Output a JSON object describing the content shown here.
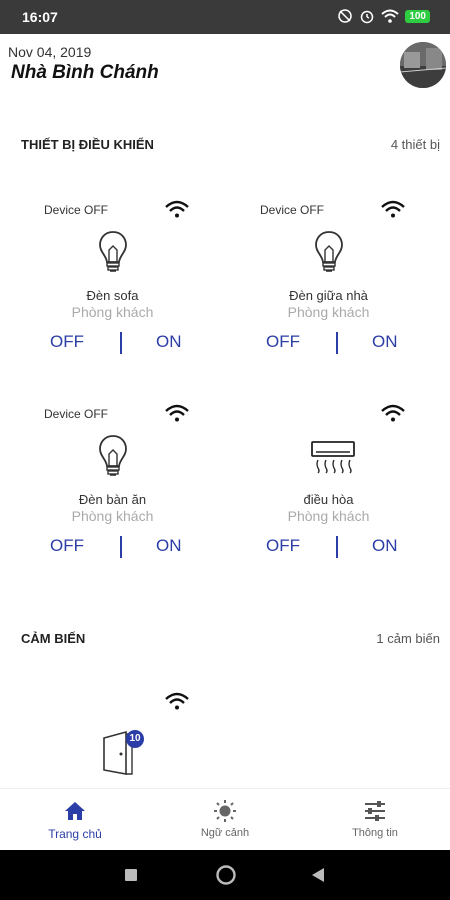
{
  "statusbar": {
    "time": "16:07",
    "battery": "100"
  },
  "header": {
    "date": "Nov 04, 2019",
    "home_name": "Nhà Bình Chánh"
  },
  "controls_section": {
    "title": "THIẾT BỊ ĐIỀU KHIỂN",
    "count": "4 thiết bị"
  },
  "devices": [
    {
      "status": "Device OFF",
      "name": "Đèn sofa",
      "room": "Phòng khách",
      "off": "OFF",
      "on": "ON",
      "icon": "bulb-icon"
    },
    {
      "status": "Device OFF",
      "name": "Đèn giữa nhà",
      "room": "Phòng khách",
      "off": "OFF",
      "on": "ON",
      "icon": "bulb-icon"
    },
    {
      "status": "Device OFF",
      "name": "Đèn bàn ăn",
      "room": "Phòng khách",
      "off": "OFF",
      "on": "ON",
      "icon": "bulb-icon"
    },
    {
      "status": "",
      "name": "điều hòa",
      "room": "Phòng khách",
      "off": "OFF",
      "on": "ON",
      "icon": "air-conditioner-icon"
    }
  ],
  "sensors_section": {
    "title": "CẢM BIẾN",
    "count": "1 cảm biến"
  },
  "sensor": {
    "badge": "10",
    "icon": "door-sensor-icon"
  },
  "bottom_nav": [
    {
      "label": "Trang chủ",
      "icon": "home-icon",
      "active": true
    },
    {
      "label": "Ngữ cảnh",
      "icon": "sun-icon",
      "active": false
    },
    {
      "label": "Thông tin",
      "icon": "sliders-icon",
      "active": false
    }
  ],
  "colors": {
    "accent": "#2b3da6",
    "battery": "#2ecc40"
  }
}
